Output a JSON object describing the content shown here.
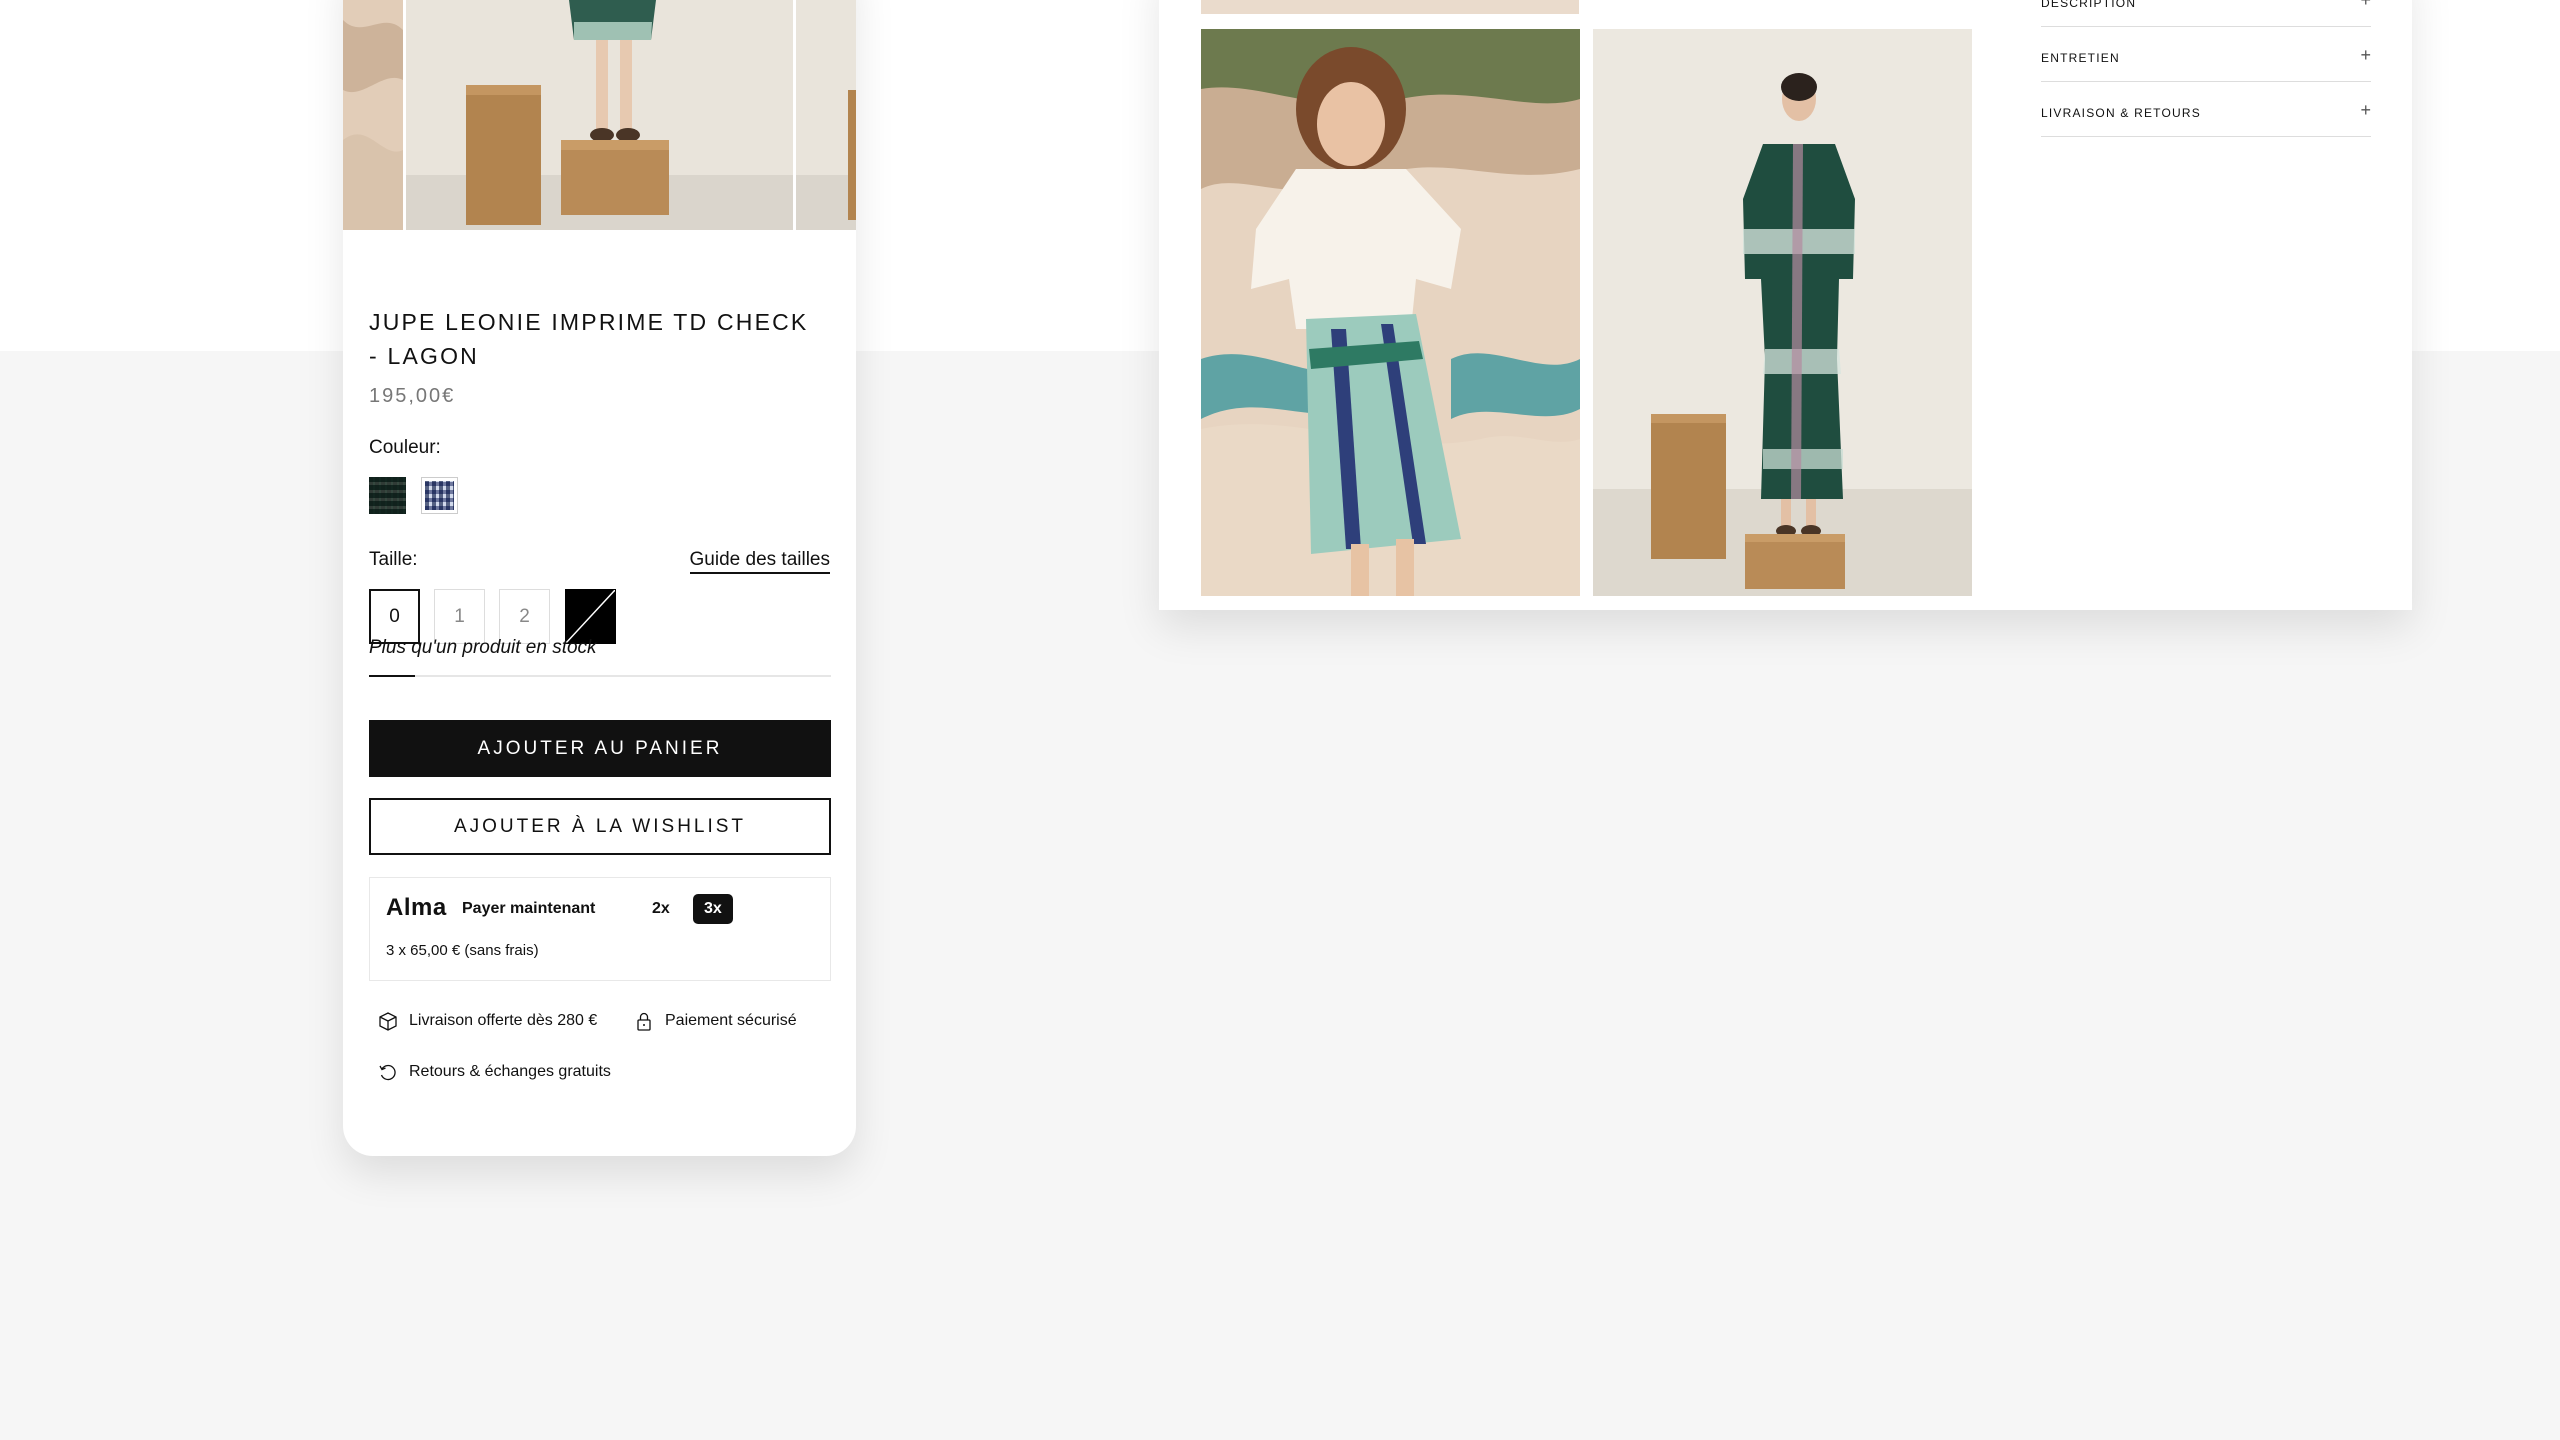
{
  "product": {
    "title": "JUPE LEONIE IMPRIME TD CHECK - LAGON",
    "price": "195,00€",
    "color_label": "Couleur:",
    "colors": [
      "green-check",
      "blue-check"
    ],
    "size_label": "Taille:",
    "size_guide": "Guide des tailles",
    "sizes": [
      "0",
      "1",
      "2",
      ""
    ],
    "selected_size": "0",
    "stock_text": "Plus qu'un produit en stock",
    "stock_level": 0.1,
    "add_to_cart": "AJOUTER AU PANIER",
    "add_to_wishlist": "AJOUTER À LA WISHLIST"
  },
  "alma": {
    "logo": "Alma",
    "options": [
      "Payer maintenant",
      "2x",
      "3x"
    ],
    "selected": "3x",
    "note": "3 x 65,00 € (sans frais)"
  },
  "features": [
    {
      "icon": "box-icon",
      "label": "Livraison offerte dès 280 €"
    },
    {
      "icon": "lock-icon",
      "label": "Paiement sécurisé"
    },
    {
      "icon": "return-icon",
      "label": "Retours & échanges gratuits"
    }
  ],
  "desktop": {
    "accordion": [
      {
        "label": "DESCRIPTION",
        "icon": "+"
      },
      {
        "label": "ENTRETIEN",
        "icon": "+"
      },
      {
        "label": "LIVRAISON & RETOURS",
        "icon": "+"
      }
    ]
  },
  "colors": {
    "accent": "#111111",
    "background": "#f6f6f6",
    "sand": "#e6d3bf",
    "skirt_green": "#2f6d5c"
  }
}
